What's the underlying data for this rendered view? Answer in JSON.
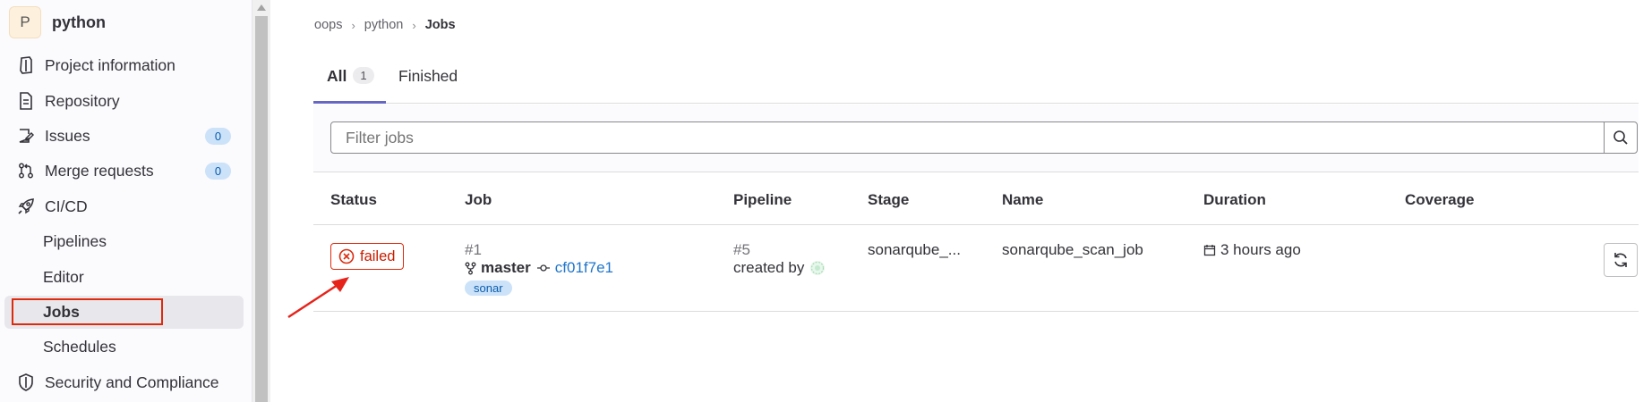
{
  "sidebar": {
    "project": {
      "avatar_letter": "P",
      "name": "python"
    },
    "items": [
      {
        "label": "Project information",
        "icon": "project-info-icon"
      },
      {
        "label": "Repository",
        "icon": "document-icon"
      },
      {
        "label": "Issues",
        "icon": "issues-icon",
        "count": "0"
      },
      {
        "label": "Merge requests",
        "icon": "merge-request-icon",
        "count": "0"
      },
      {
        "label": "CI/CD",
        "icon": "rocket-icon"
      }
    ],
    "cicd_sub": [
      {
        "label": "Pipelines"
      },
      {
        "label": "Editor"
      },
      {
        "label": "Jobs",
        "active": true
      },
      {
        "label": "Schedules"
      }
    ],
    "security": {
      "label": "Security and Compliance",
      "icon": "shield-icon"
    }
  },
  "breadcrumb": [
    "oops",
    "python",
    "Jobs"
  ],
  "tabs": [
    {
      "label": "All",
      "count": "1",
      "active": true
    },
    {
      "label": "Finished"
    }
  ],
  "filter": {
    "placeholder": "Filter jobs"
  },
  "table": {
    "headers": [
      "Status",
      "Job",
      "Pipeline",
      "Stage",
      "Name",
      "Duration",
      "Coverage"
    ],
    "rows": [
      {
        "status": "failed",
        "job_id": "#1",
        "ref": "master",
        "commit": "cf01f7e1",
        "tag": "sonar",
        "pipeline_id": "#5",
        "created_by": "created by",
        "stage": "sonarqube_...",
        "name": "sonarqube_scan_job",
        "duration": "3 hours ago",
        "coverage": ""
      }
    ]
  },
  "colors": {
    "failed": "#dd2b0e",
    "link": "#1f75cb",
    "active_tab": "#6666c4",
    "annotation": "#e5231b"
  }
}
